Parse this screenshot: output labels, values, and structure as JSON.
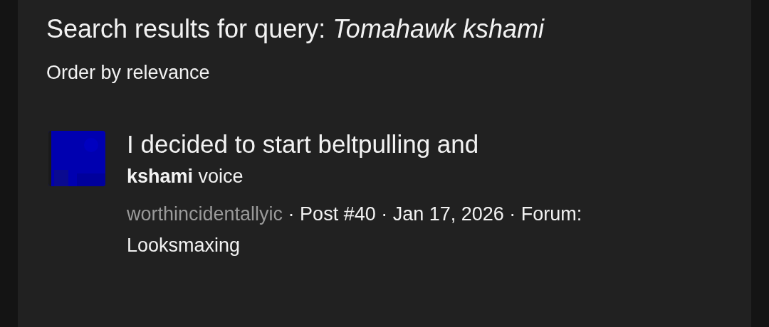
{
  "heading": "Search results for query: *Tomahawk kshami*",
  "order": "Order by relevance",
  "results": [
    {
      "title": "I decided to start beltpulling and",
      "snippet": "**kshami** voice",
      "author": "worthincidentallyic",
      "meta": " · Post #40 · Jan 17, 2026 · Forum: Looksmaxing"
    }
  ]
}
